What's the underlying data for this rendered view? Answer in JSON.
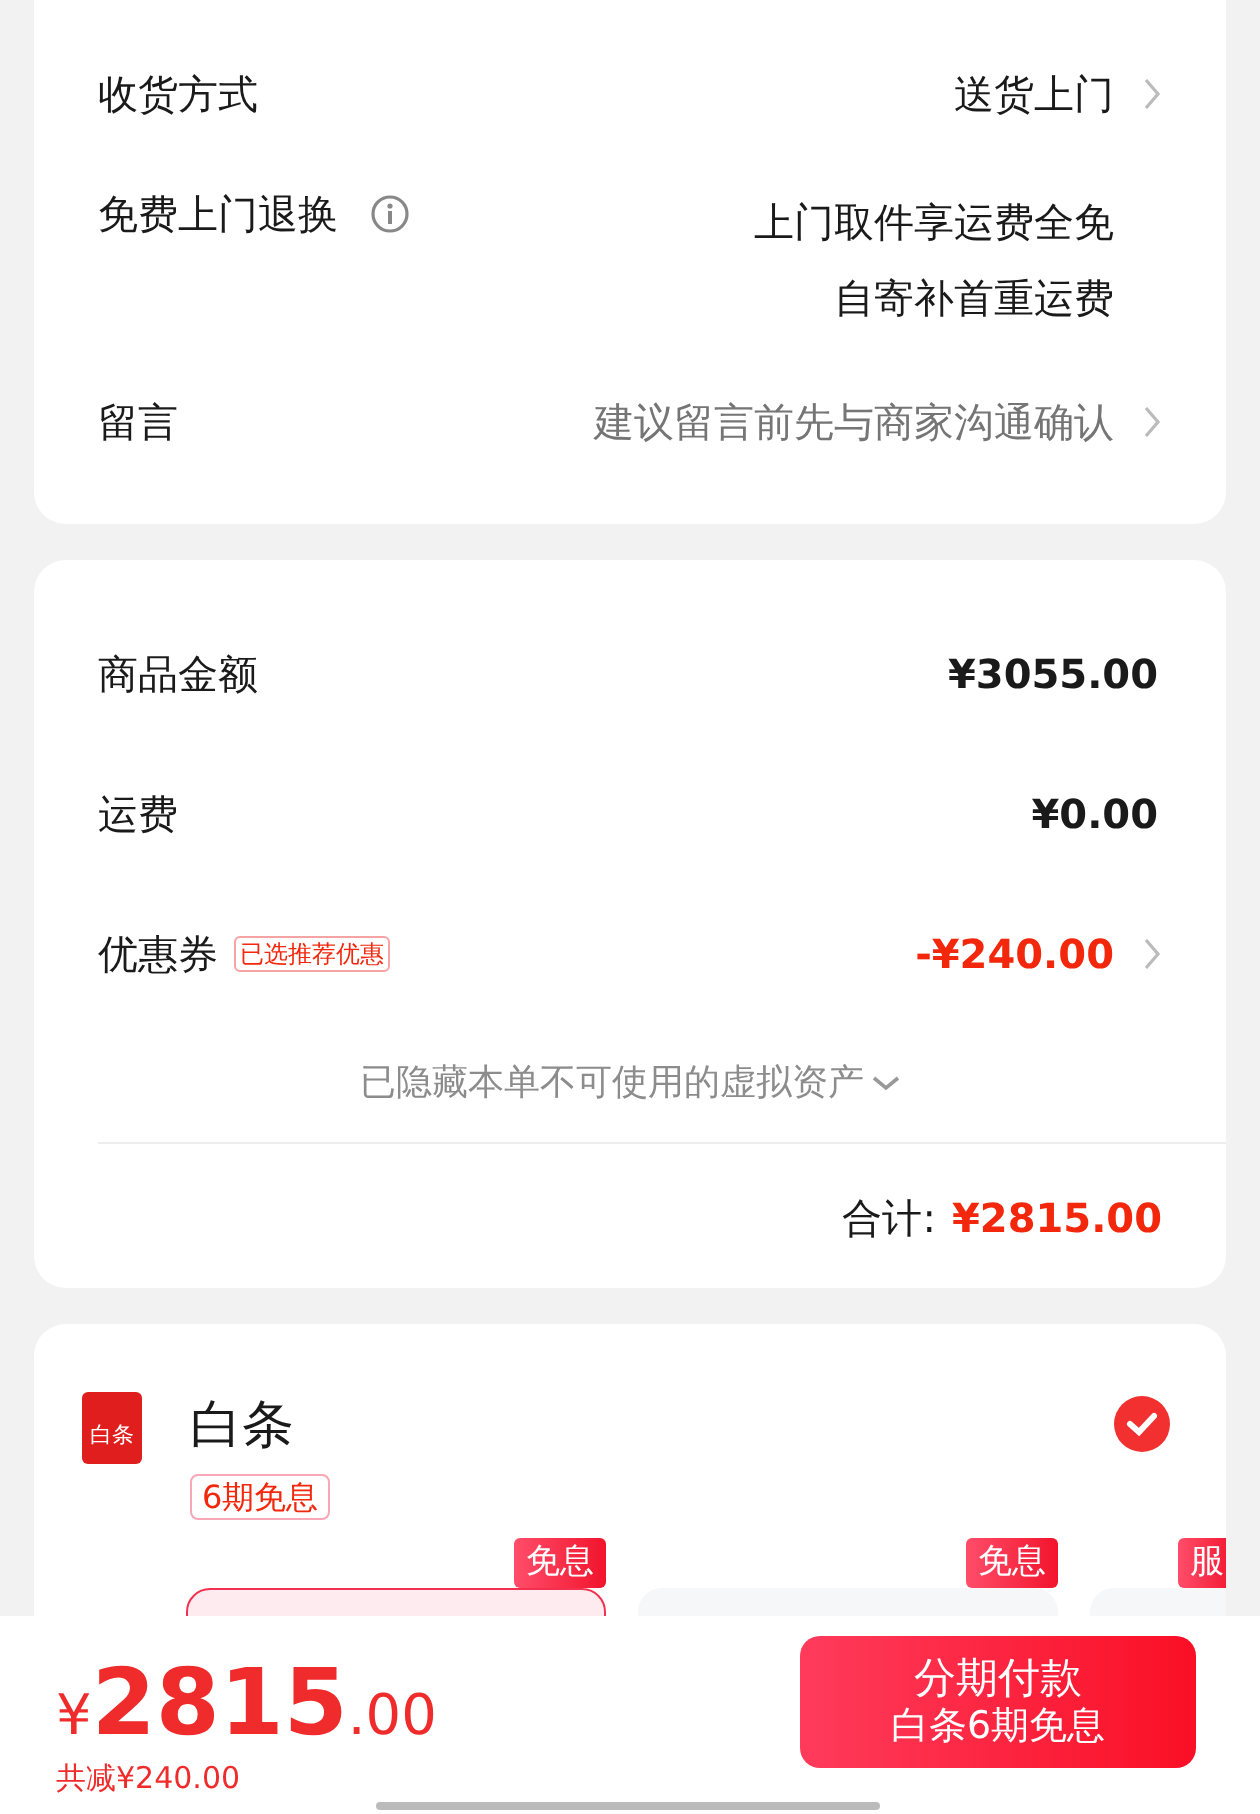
{
  "delivery": {
    "rows": [
      {
        "kind": "select",
        "label": "收货方式",
        "value": "送货上门"
      },
      {
        "kind": "info",
        "label": "免费上门退换",
        "lines": [
          "上门取件享运费全免",
          "自寄补首重运费"
        ]
      },
      {
        "kind": "note",
        "label": "留言",
        "placeholder": "建议留言前先与商家沟通确认"
      }
    ]
  },
  "summary": {
    "rows": [
      {
        "kind": "amount",
        "label": "商品金额",
        "value": "¥3055.00"
      },
      {
        "kind": "amount",
        "label": "运费",
        "value": "¥0.00"
      },
      {
        "kind": "discount",
        "label": "优惠券",
        "tag": "已选推荐优惠",
        "value": "-¥240.00"
      }
    ],
    "hidden_note": "已隐藏本单不可使用的虚拟资产",
    "total_label": "合计:",
    "total_value": "¥2815.00"
  },
  "payment": {
    "logo_text": "白条",
    "name": "白条",
    "tag": "6期免息",
    "selected": true,
    "plans": [
      {
        "tag": "免息",
        "selected": true
      },
      {
        "tag": "免息",
        "selected": false
      },
      {
        "tag": "服",
        "selected": false
      }
    ]
  },
  "bottom_bar": {
    "currency": "¥",
    "amount": "2815",
    "decimals": ".00",
    "saving": "共减¥240.00",
    "button_lines": [
      "分期付款",
      "白条6期免息"
    ]
  }
}
